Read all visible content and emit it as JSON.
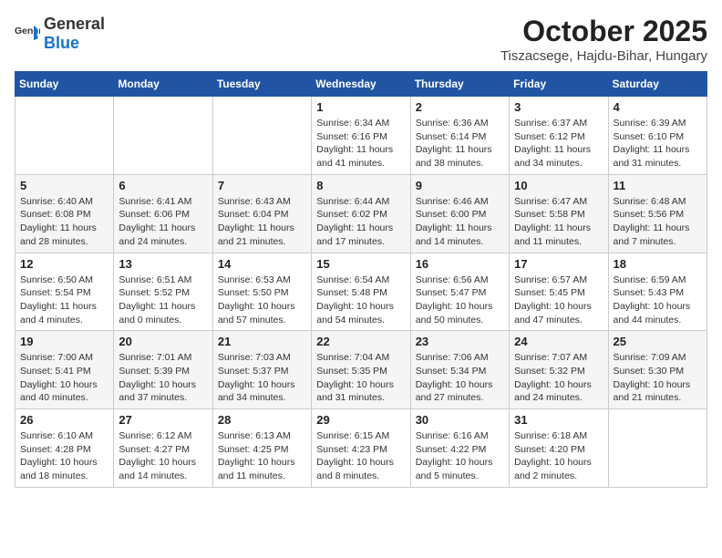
{
  "header": {
    "logo_general": "General",
    "logo_blue": "Blue",
    "month": "October 2025",
    "location": "Tiszacsege, Hajdu-Bihar, Hungary"
  },
  "days_of_week": [
    "Sunday",
    "Monday",
    "Tuesday",
    "Wednesday",
    "Thursday",
    "Friday",
    "Saturday"
  ],
  "weeks": [
    [
      {
        "day": "",
        "sunrise": "",
        "sunset": "",
        "daylight": ""
      },
      {
        "day": "",
        "sunrise": "",
        "sunset": "",
        "daylight": ""
      },
      {
        "day": "",
        "sunrise": "",
        "sunset": "",
        "daylight": ""
      },
      {
        "day": "1",
        "sunrise": "Sunrise: 6:34 AM",
        "sunset": "Sunset: 6:16 PM",
        "daylight": "Daylight: 11 hours and 41 minutes."
      },
      {
        "day": "2",
        "sunrise": "Sunrise: 6:36 AM",
        "sunset": "Sunset: 6:14 PM",
        "daylight": "Daylight: 11 hours and 38 minutes."
      },
      {
        "day": "3",
        "sunrise": "Sunrise: 6:37 AM",
        "sunset": "Sunset: 6:12 PM",
        "daylight": "Daylight: 11 hours and 34 minutes."
      },
      {
        "day": "4",
        "sunrise": "Sunrise: 6:39 AM",
        "sunset": "Sunset: 6:10 PM",
        "daylight": "Daylight: 11 hours and 31 minutes."
      }
    ],
    [
      {
        "day": "5",
        "sunrise": "Sunrise: 6:40 AM",
        "sunset": "Sunset: 6:08 PM",
        "daylight": "Daylight: 11 hours and 28 minutes."
      },
      {
        "day": "6",
        "sunrise": "Sunrise: 6:41 AM",
        "sunset": "Sunset: 6:06 PM",
        "daylight": "Daylight: 11 hours and 24 minutes."
      },
      {
        "day": "7",
        "sunrise": "Sunrise: 6:43 AM",
        "sunset": "Sunset: 6:04 PM",
        "daylight": "Daylight: 11 hours and 21 minutes."
      },
      {
        "day": "8",
        "sunrise": "Sunrise: 6:44 AM",
        "sunset": "Sunset: 6:02 PM",
        "daylight": "Daylight: 11 hours and 17 minutes."
      },
      {
        "day": "9",
        "sunrise": "Sunrise: 6:46 AM",
        "sunset": "Sunset: 6:00 PM",
        "daylight": "Daylight: 11 hours and 14 minutes."
      },
      {
        "day": "10",
        "sunrise": "Sunrise: 6:47 AM",
        "sunset": "Sunset: 5:58 PM",
        "daylight": "Daylight: 11 hours and 11 minutes."
      },
      {
        "day": "11",
        "sunrise": "Sunrise: 6:48 AM",
        "sunset": "Sunset: 5:56 PM",
        "daylight": "Daylight: 11 hours and 7 minutes."
      }
    ],
    [
      {
        "day": "12",
        "sunrise": "Sunrise: 6:50 AM",
        "sunset": "Sunset: 5:54 PM",
        "daylight": "Daylight: 11 hours and 4 minutes."
      },
      {
        "day": "13",
        "sunrise": "Sunrise: 6:51 AM",
        "sunset": "Sunset: 5:52 PM",
        "daylight": "Daylight: 11 hours and 0 minutes."
      },
      {
        "day": "14",
        "sunrise": "Sunrise: 6:53 AM",
        "sunset": "Sunset: 5:50 PM",
        "daylight": "Daylight: 10 hours and 57 minutes."
      },
      {
        "day": "15",
        "sunrise": "Sunrise: 6:54 AM",
        "sunset": "Sunset: 5:48 PM",
        "daylight": "Daylight: 10 hours and 54 minutes."
      },
      {
        "day": "16",
        "sunrise": "Sunrise: 6:56 AM",
        "sunset": "Sunset: 5:47 PM",
        "daylight": "Daylight: 10 hours and 50 minutes."
      },
      {
        "day": "17",
        "sunrise": "Sunrise: 6:57 AM",
        "sunset": "Sunset: 5:45 PM",
        "daylight": "Daylight: 10 hours and 47 minutes."
      },
      {
        "day": "18",
        "sunrise": "Sunrise: 6:59 AM",
        "sunset": "Sunset: 5:43 PM",
        "daylight": "Daylight: 10 hours and 44 minutes."
      }
    ],
    [
      {
        "day": "19",
        "sunrise": "Sunrise: 7:00 AM",
        "sunset": "Sunset: 5:41 PM",
        "daylight": "Daylight: 10 hours and 40 minutes."
      },
      {
        "day": "20",
        "sunrise": "Sunrise: 7:01 AM",
        "sunset": "Sunset: 5:39 PM",
        "daylight": "Daylight: 10 hours and 37 minutes."
      },
      {
        "day": "21",
        "sunrise": "Sunrise: 7:03 AM",
        "sunset": "Sunset: 5:37 PM",
        "daylight": "Daylight: 10 hours and 34 minutes."
      },
      {
        "day": "22",
        "sunrise": "Sunrise: 7:04 AM",
        "sunset": "Sunset: 5:35 PM",
        "daylight": "Daylight: 10 hours and 31 minutes."
      },
      {
        "day": "23",
        "sunrise": "Sunrise: 7:06 AM",
        "sunset": "Sunset: 5:34 PM",
        "daylight": "Daylight: 10 hours and 27 minutes."
      },
      {
        "day": "24",
        "sunrise": "Sunrise: 7:07 AM",
        "sunset": "Sunset: 5:32 PM",
        "daylight": "Daylight: 10 hours and 24 minutes."
      },
      {
        "day": "25",
        "sunrise": "Sunrise: 7:09 AM",
        "sunset": "Sunset: 5:30 PM",
        "daylight": "Daylight: 10 hours and 21 minutes."
      }
    ],
    [
      {
        "day": "26",
        "sunrise": "Sunrise: 6:10 AM",
        "sunset": "Sunset: 4:28 PM",
        "daylight": "Daylight: 10 hours and 18 minutes."
      },
      {
        "day": "27",
        "sunrise": "Sunrise: 6:12 AM",
        "sunset": "Sunset: 4:27 PM",
        "daylight": "Daylight: 10 hours and 14 minutes."
      },
      {
        "day": "28",
        "sunrise": "Sunrise: 6:13 AM",
        "sunset": "Sunset: 4:25 PM",
        "daylight": "Daylight: 10 hours and 11 minutes."
      },
      {
        "day": "29",
        "sunrise": "Sunrise: 6:15 AM",
        "sunset": "Sunset: 4:23 PM",
        "daylight": "Daylight: 10 hours and 8 minutes."
      },
      {
        "day": "30",
        "sunrise": "Sunrise: 6:16 AM",
        "sunset": "Sunset: 4:22 PM",
        "daylight": "Daylight: 10 hours and 5 minutes."
      },
      {
        "day": "31",
        "sunrise": "Sunrise: 6:18 AM",
        "sunset": "Sunset: 4:20 PM",
        "daylight": "Daylight: 10 hours and 2 minutes."
      },
      {
        "day": "",
        "sunrise": "",
        "sunset": "",
        "daylight": ""
      }
    ]
  ]
}
